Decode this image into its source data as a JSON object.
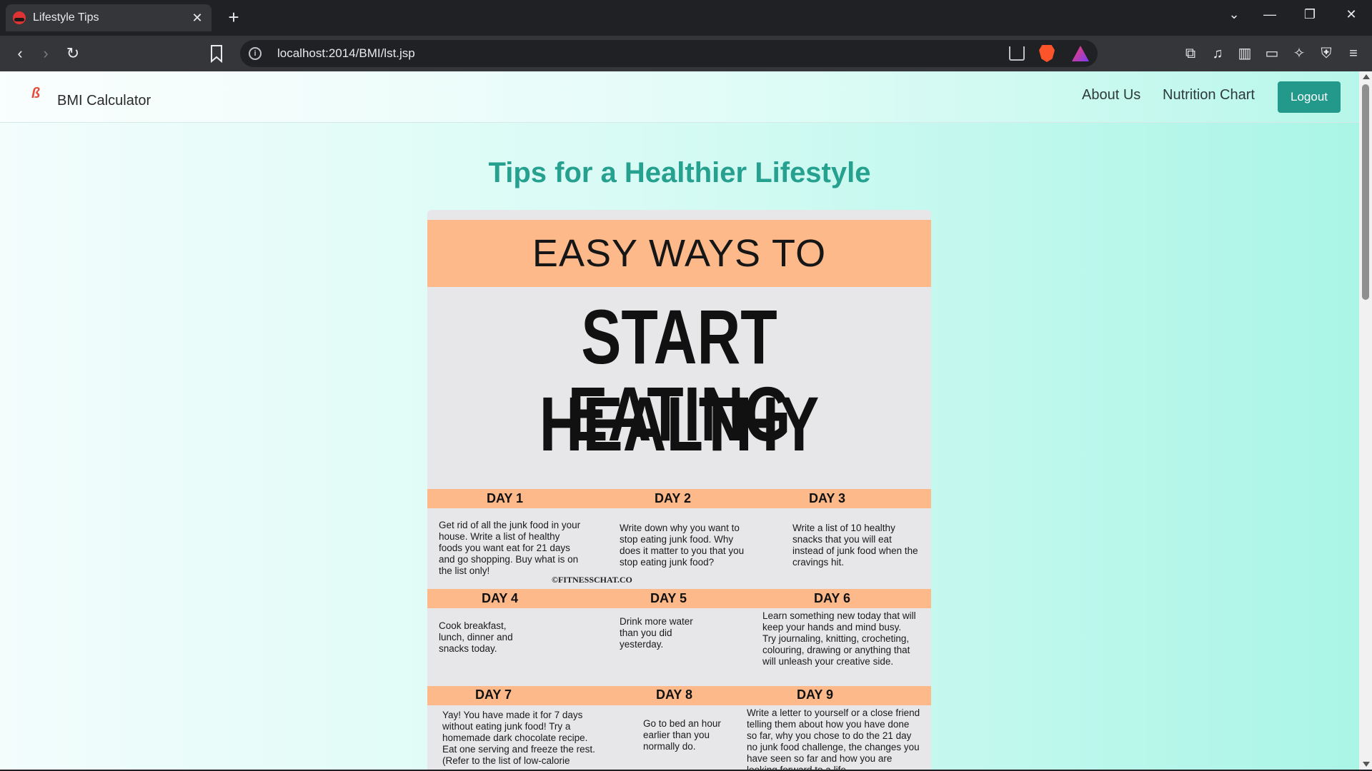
{
  "browser": {
    "tab_title": "Lifestyle Tips",
    "tab_close": "✕",
    "new_tab": "+",
    "url": "localhost:2014/BMI/lst.jsp"
  },
  "navbar": {
    "brand": "BMI Calculator",
    "links": [
      "About Us",
      "Nutrition Chart"
    ],
    "logout": "Logout"
  },
  "page": {
    "title": "Tips for a Healthier Lifestyle"
  },
  "poster": {
    "heading_top": "EASY WAYS TO",
    "heading_line1": "START EATING",
    "heading_line2": "HEALTHY",
    "copyright": "©FITNESSCHAT.CO",
    "days": [
      {
        "label": "DAY 1",
        "text": "Get rid of all the junk food in your house. Write a list of healthy foods you want eat for 21 days and go shopping. Buy what is on the list only!"
      },
      {
        "label": "DAY 2",
        "text": "Write down why you want to stop eating junk food. Why does it matter to you that you stop eating junk food?"
      },
      {
        "label": "DAY 3",
        "text": "Write a list of 10 healthy snacks that you will eat instead of junk food when the cravings hit."
      },
      {
        "label": "DAY 4",
        "text": "Cook breakfast, lunch, dinner and snacks today."
      },
      {
        "label": "DAY 5",
        "text": "Drink more water than you did yesterday."
      },
      {
        "label": "DAY 6",
        "text": "Learn something new today that will keep your hands and mind busy. Try journaling, knitting, crocheting, colouring, drawing or anything that will unleash your creative side."
      },
      {
        "label": "DAY 7",
        "text": "Yay! You have made it for 7 days without eating junk food! Try a homemade dark chocolate recipe. Eat one serving and freeze the rest. (Refer to the list of low-calorie"
      },
      {
        "label": "DAY 8",
        "text": "Go to bed an hour earlier than you normally do."
      },
      {
        "label": "DAY 9",
        "text": "Write a letter to yourself or a close friend telling them about how you have done so far, why you chose to do the 21 day no junk food challenge, the changes you have seen so far and how you are looking forward to a life"
      }
    ]
  }
}
